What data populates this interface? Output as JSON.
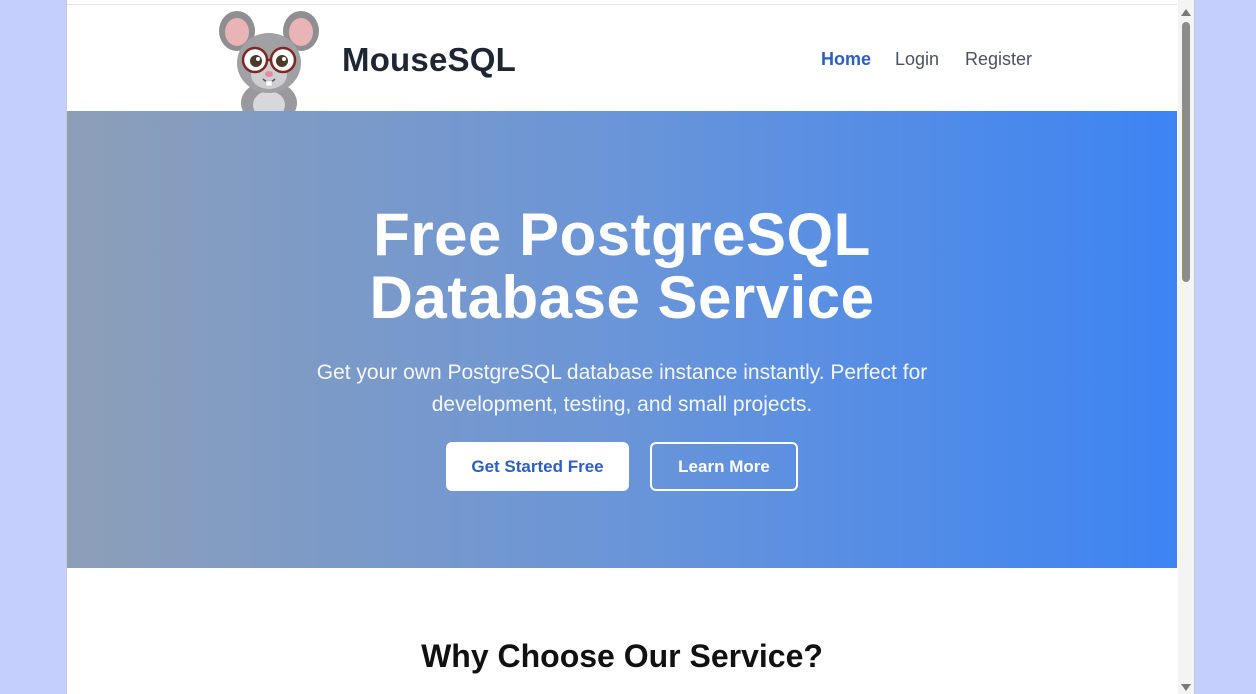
{
  "brand": {
    "name": "MouseSQL",
    "logo_icon": "mouse-with-glasses-icon"
  },
  "nav": {
    "items": [
      {
        "label": "Home",
        "active": true
      },
      {
        "label": "Login",
        "active": false
      },
      {
        "label": "Register",
        "active": false
      }
    ]
  },
  "hero": {
    "title_line1": "Free PostgreSQL",
    "title_line2": "Database Service",
    "subtitle": "Get your own PostgreSQL database instance instantly. Perfect for development, testing, and small projects.",
    "primary_button": "Get Started Free",
    "secondary_button": "Learn More"
  },
  "features": {
    "title": "Why Choose Our Service?"
  },
  "colors": {
    "background": "#c5cffd",
    "accent": "#2d5fc0",
    "hero_gradient_start": "#8d9fb8",
    "hero_gradient_end": "#3d84f3"
  }
}
